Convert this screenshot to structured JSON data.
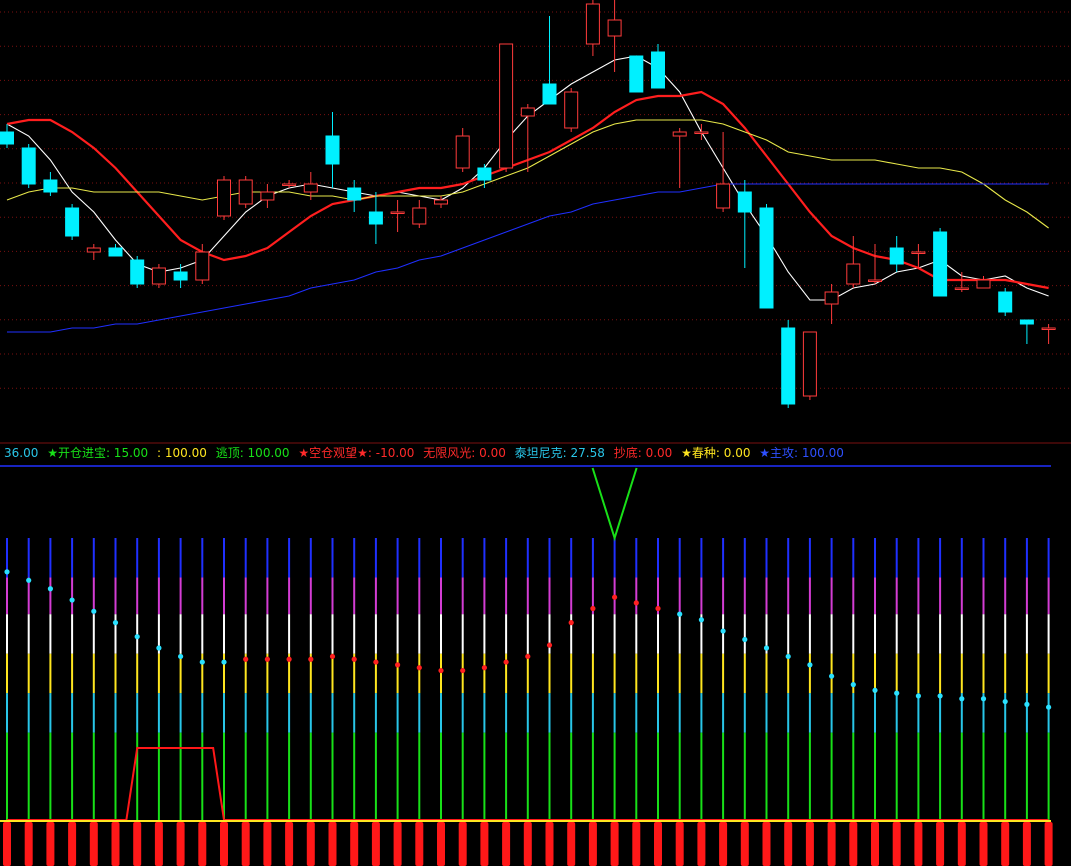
{
  "colors": {
    "background": "#000000",
    "up_candle": "#ff3b3b",
    "down_candle": "#00f0ff",
    "ma_fast": "#ffffff",
    "ma_red": "#ff1e1e",
    "ma_yellow": "#e8e84a",
    "ma_blue": "#1f2fff",
    "grid": "#7a1010"
  },
  "legend": {
    "item0": "36.00",
    "item1": "★开仓进宝: 15.00",
    "item2": ": 100.00",
    "item3": "逃顶: 100.00",
    "item4": "★空仓观望★: -10.00",
    "item5": "无限风光: 0.00",
    "item6": "泰坦尼克: 27.58",
    "item7": "抄底: 0.00",
    "item8": "★春种: 0.00",
    "item9": "★主攻: 100.00"
  },
  "chart_data": [
    {
      "type": "candlestick",
      "panel": "price",
      "ylim": [
        0,
        100
      ],
      "grid": "horizontal dotted",
      "candles": [
        {
          "o": 72,
          "h": 74,
          "l": 68,
          "c": 69
        },
        {
          "o": 68,
          "h": 69,
          "l": 58,
          "c": 59
        },
        {
          "o": 60,
          "h": 62,
          "l": 56,
          "c": 57
        },
        {
          "o": 53,
          "h": 54,
          "l": 45,
          "c": 46
        },
        {
          "o": 42,
          "h": 44,
          "l": 40,
          "c": 43
        },
        {
          "o": 43,
          "h": 44,
          "l": 41,
          "c": 41
        },
        {
          "o": 40,
          "h": 41,
          "l": 33,
          "c": 34
        },
        {
          "o": 34,
          "h": 39,
          "l": 33,
          "c": 38
        },
        {
          "o": 37,
          "h": 39,
          "l": 33,
          "c": 35
        },
        {
          "o": 35,
          "h": 44,
          "l": 34,
          "c": 42
        },
        {
          "o": 51,
          "h": 61,
          "l": 50,
          "c": 60
        },
        {
          "o": 54,
          "h": 61,
          "l": 53,
          "c": 60
        },
        {
          "o": 55,
          "h": 59,
          "l": 53,
          "c": 57
        },
        {
          "o": 59,
          "h": 60,
          "l": 58,
          "c": 59
        },
        {
          "o": 57,
          "h": 62,
          "l": 55,
          "c": 59
        },
        {
          "o": 71,
          "h": 77,
          "l": 58,
          "c": 64
        },
        {
          "o": 58,
          "h": 60,
          "l": 52,
          "c": 55
        },
        {
          "o": 52,
          "h": 57,
          "l": 44,
          "c": 49
        },
        {
          "o": 52,
          "h": 55,
          "l": 47,
          "c": 52
        },
        {
          "o": 49,
          "h": 55,
          "l": 48,
          "c": 53
        },
        {
          "o": 54,
          "h": 56,
          "l": 53,
          "c": 55
        },
        {
          "o": 63,
          "h": 73,
          "l": 62,
          "c": 71
        },
        {
          "o": 63,
          "h": 64,
          "l": 58,
          "c": 60
        },
        {
          "o": 63,
          "h": 94,
          "l": 62,
          "c": 94
        },
        {
          "o": 76,
          "h": 79,
          "l": 62,
          "c": 78
        },
        {
          "o": 84,
          "h": 101,
          "l": 79,
          "c": 79
        },
        {
          "o": 73,
          "h": 83,
          "l": 72,
          "c": 82
        },
        {
          "o": 94,
          "h": 118,
          "l": 91,
          "c": 104
        },
        {
          "o": 96,
          "h": 107,
          "l": 87,
          "c": 100
        },
        {
          "o": 91,
          "h": 91,
          "l": 82,
          "c": 82
        },
        {
          "o": 92,
          "h": 94,
          "l": 83,
          "c": 83
        },
        {
          "o": 71,
          "h": 73,
          "l": 58,
          "c": 72
        },
        {
          "o": 72,
          "h": 74,
          "l": 70,
          "c": 72
        },
        {
          "o": 53,
          "h": 72,
          "l": 52,
          "c": 59
        },
        {
          "o": 57,
          "h": 60,
          "l": 38,
          "c": 52
        },
        {
          "o": 53,
          "h": 54,
          "l": 28,
          "c": 28
        },
        {
          "o": 23,
          "h": 25,
          "l": 3,
          "c": 4
        },
        {
          "o": 6,
          "h": 22,
          "l": 5,
          "c": 22
        },
        {
          "o": 29,
          "h": 34,
          "l": 24,
          "c": 32
        },
        {
          "o": 34,
          "h": 46,
          "l": 33,
          "c": 39
        },
        {
          "o": 35,
          "h": 44,
          "l": 34,
          "c": 35
        },
        {
          "o": 43,
          "h": 46,
          "l": 37,
          "c": 39
        },
        {
          "o": 42,
          "h": 44,
          "l": 38,
          "c": 42
        },
        {
          "o": 47,
          "h": 48,
          "l": 32,
          "c": 31
        },
        {
          "o": 33,
          "h": 37,
          "l": 32,
          "c": 33
        },
        {
          "o": 33,
          "h": 36,
          "l": 34,
          "c": 35
        },
        {
          "o": 32,
          "h": 33,
          "l": 26,
          "c": 27
        },
        {
          "o": 25,
          "h": 25,
          "l": 19,
          "c": 24
        },
        {
          "o": 23,
          "h": 24,
          "l": 19,
          "c": 23
        }
      ],
      "series": [
        {
          "color_key": "ma_fast",
          "values": [
            74,
            71,
            65,
            57,
            52,
            45,
            39,
            37,
            38,
            40,
            46,
            52,
            56,
            58,
            59,
            58,
            57,
            56,
            57,
            56,
            55,
            58,
            63,
            70,
            76,
            80,
            84,
            87,
            90,
            91,
            88,
            82,
            72,
            63,
            54,
            46,
            37,
            30,
            30,
            33,
            34,
            37,
            38,
            40,
            36,
            35,
            36,
            33,
            31
          ]
        },
        {
          "color_key": "ma_red",
          "values": [
            74,
            75,
            75,
            72,
            68,
            63,
            57,
            51,
            45,
            42,
            40,
            41,
            43,
            47,
            51,
            54,
            55,
            56,
            57,
            58,
            58,
            59,
            61,
            63,
            65,
            67,
            70,
            73,
            77,
            80,
            81,
            81,
            82,
            79,
            73,
            66,
            59,
            52,
            46,
            43,
            41,
            40,
            38,
            35,
            35,
            35,
            35,
            34,
            33
          ]
        },
        {
          "color_key": "ma_yellow",
          "values": [
            55,
            57,
            58,
            58,
            57,
            57,
            57,
            57,
            56,
            55,
            56,
            57,
            57,
            57,
            56,
            56,
            55,
            56,
            56,
            56,
            56,
            57,
            59,
            61,
            63,
            66,
            69,
            72,
            74,
            75,
            75,
            75,
            75,
            74,
            72,
            70,
            67,
            66,
            65,
            65,
            65,
            64,
            63,
            63,
            62,
            59,
            55,
            52,
            48
          ]
        },
        {
          "color_key": "ma_blue",
          "values": [
            22,
            22,
            22,
            23,
            23,
            24,
            24,
            25,
            26,
            27,
            28,
            29,
            30,
            31,
            33,
            34,
            35,
            37,
            38,
            40,
            41,
            43,
            45,
            47,
            49,
            51,
            52,
            54,
            55,
            56,
            57,
            57,
            58,
            59,
            59,
            59,
            59,
            59,
            59,
            59,
            59,
            59,
            59,
            59,
            59,
            59,
            59,
            59,
            59
          ]
        }
      ]
    },
    {
      "type": "bar",
      "panel": "indicator",
      "ylim": [
        0,
        100
      ],
      "bands": [
        {
          "name": "band1",
          "color": "#ff1818",
          "range": [
            0,
            0
          ]
        },
        {
          "name": "band2",
          "color": "#ffe620",
          "range": [
            0,
            0
          ]
        },
        {
          "name": "band3",
          "color": "#18e018",
          "range": [
            0,
            0
          ]
        },
        {
          "name": "band4",
          "color": "#29c6e8",
          "range": [
            0,
            0
          ]
        },
        {
          "name": "band5",
          "color": "#ffe620",
          "range": [
            0,
            0
          ]
        },
        {
          "name": "band6",
          "color": "#ffffff",
          "range": [
            0,
            0
          ]
        },
        {
          "name": "band7",
          "color": "#d43dd4",
          "range": [
            0,
            0
          ]
        },
        {
          "name": "band8",
          "color": "#2030ff",
          "range": [
            0,
            0
          ]
        }
      ],
      "dots": [
        88,
        85,
        82,
        78,
        74,
        70,
        65,
        61,
        58,
        56,
        56,
        57,
        57,
        57,
        57,
        58,
        57,
        56,
        55,
        54,
        53,
        53,
        54,
        56,
        58,
        62,
        70,
        75,
        79,
        77,
        75,
        73,
        71,
        67,
        64,
        61,
        58,
        55,
        51,
        48,
        46,
        45,
        44,
        44,
        43,
        43,
        42,
        41,
        40
      ],
      "dot_red_from": 11,
      "dot_red_to": 30,
      "signal_steps": [
        0,
        0,
        0,
        0,
        0,
        0,
        1,
        1,
        1,
        1,
        0,
        0,
        0,
        0,
        0,
        0,
        0,
        0,
        0,
        0,
        0,
        0,
        0,
        0,
        0,
        0,
        0,
        0,
        0,
        0,
        0,
        0,
        0,
        0,
        0,
        0,
        0,
        0,
        0,
        0,
        0,
        0,
        0,
        0,
        0,
        0,
        0,
        0,
        0
      ],
      "top_marker_index": 28
    }
  ]
}
